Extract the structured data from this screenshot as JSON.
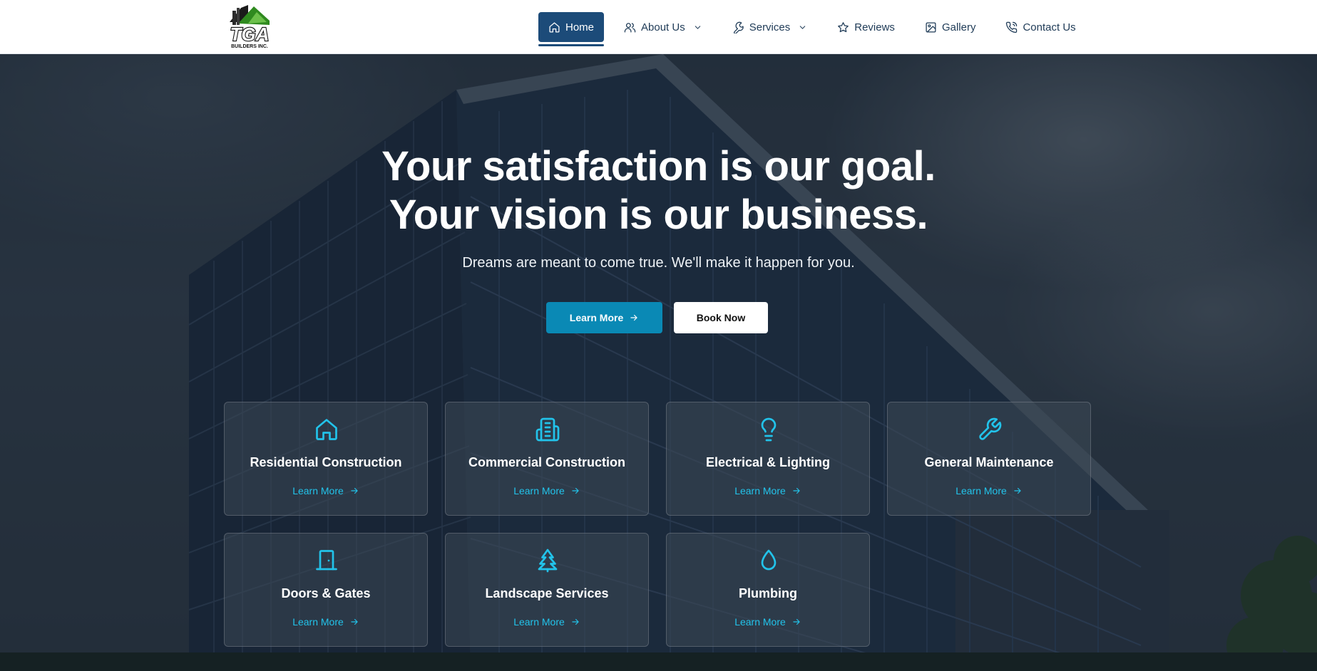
{
  "brand": {
    "logo_text": "TGA",
    "logo_subtext": "BUILDERS INC."
  },
  "nav": {
    "items": [
      {
        "label": "Home",
        "icon": "home-icon",
        "active": true
      },
      {
        "label": "About Us",
        "icon": "users-icon",
        "dropdown": true
      },
      {
        "label": "Services",
        "icon": "wrench-icon",
        "dropdown": true
      },
      {
        "label": "Reviews",
        "icon": "star-icon"
      },
      {
        "label": "Gallery",
        "icon": "image-icon"
      },
      {
        "label": "Contact Us",
        "icon": "phone-icon"
      }
    ]
  },
  "hero": {
    "headline_line1": "Your satisfaction is our goal.",
    "headline_line2": "Your vision is our business.",
    "subheadline": "Dreams are meant to come true. We'll make it happen for you.",
    "primary_button": "Learn More",
    "secondary_button": "Book Now"
  },
  "services": [
    {
      "title": "Residential Construction",
      "link": "Learn More",
      "icon": "house-icon"
    },
    {
      "title": "Commercial Construction",
      "link": "Learn More",
      "icon": "building-icon"
    },
    {
      "title": "Electrical & Lighting",
      "link": "Learn More",
      "icon": "lightbulb-icon"
    },
    {
      "title": "General Maintenance",
      "link": "Learn More",
      "icon": "wrench-icon"
    },
    {
      "title": "Doors & Gates",
      "link": "Learn More",
      "icon": "door-icon"
    },
    {
      "title": "Landscape Services",
      "link": "Learn More",
      "icon": "tree-icon"
    },
    {
      "title": "Plumbing",
      "link": "Learn More",
      "icon": "droplet-icon"
    }
  ],
  "colors": {
    "nav_active_bg": "#1c4b79",
    "nav_text": "#1f3b57",
    "primary_button": "#0a89b5",
    "accent_cyan": "#22c3ea"
  }
}
